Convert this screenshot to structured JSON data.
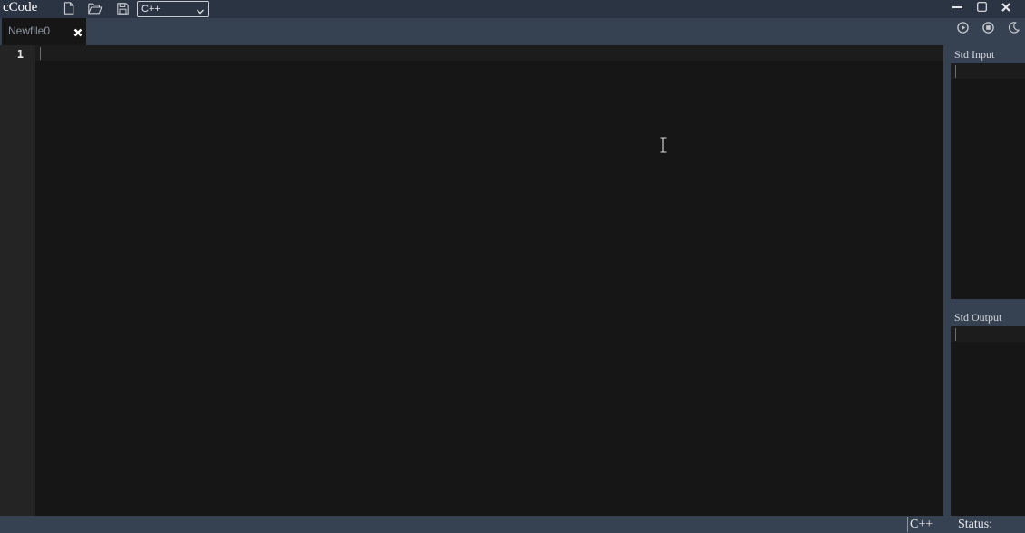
{
  "app": {
    "title": "cCode"
  },
  "toolbar": {
    "new_file_icon": "new-file-icon",
    "open_folder_icon": "open-folder-icon",
    "save_icon": "save-icon",
    "language_select": {
      "value": "C++"
    }
  },
  "window_controls": [
    "minimize-icon",
    "maximize-icon",
    "close-icon"
  ],
  "tabs": [
    {
      "label": "Newfile0",
      "active": true,
      "close_icon": "close-icon"
    }
  ],
  "actions": [
    "run-icon",
    "stop-icon",
    "dark-mode-icon"
  ],
  "editor": {
    "line_numbers": [
      "1"
    ],
    "content": ""
  },
  "side_panel": {
    "input": {
      "title": "Std Input",
      "content": ""
    },
    "output": {
      "title": "Std Output",
      "content": ""
    }
  },
  "status_bar": {
    "language": "C++",
    "status_label": "Status:"
  },
  "colors": {
    "chrome": "#2b3442",
    "tabbar": "#364152",
    "editor_bg": "#161617",
    "gutter_bg": "#242424",
    "text": "#d0d4da"
  }
}
